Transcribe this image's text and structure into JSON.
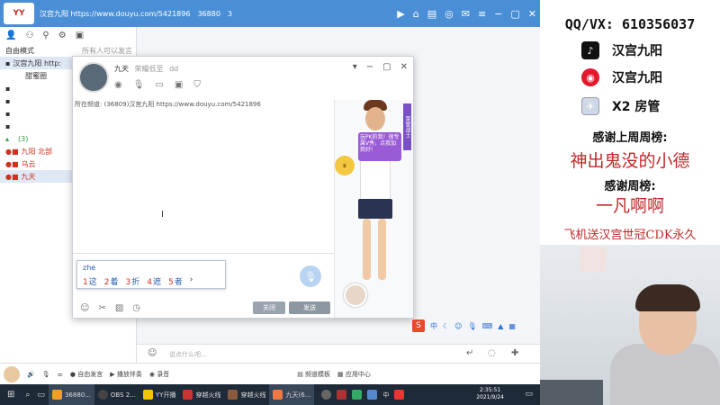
{
  "window": {
    "title": "汉宫九阳 https://www.douyu.com/5421896",
    "room_id": "36880",
    "online_count": "3",
    "logo_text": "YY"
  },
  "sidebar": {
    "mode": "自由模式",
    "search_placeholder": "所有人可以发言",
    "items": [
      {
        "label": "汉宫九阳 http:"
      },
      {
        "label": "甜蜜圈"
      },
      {
        "label": ""
      },
      {
        "label": ""
      },
      {
        "label": ""
      },
      {
        "label": ""
      },
      {
        "label": "(3)"
      },
      {
        "label": "九阳 北部"
      },
      {
        "label": "乌云"
      },
      {
        "label": "九天"
      }
    ]
  },
  "chat_window": {
    "user_name": "九天",
    "user_status": "荣耀低至",
    "user_extra": "dd",
    "notice": "所在频道: (36809)汉宫九阳 https://www.douyu.com/5421896",
    "ime_code": "zhe",
    "ime_candidates": [
      {
        "num": "1",
        "word": "这"
      },
      {
        "num": "2",
        "word": "着"
      },
      {
        "num": "3",
        "word": "折"
      },
      {
        "num": "4",
        "word": "遮"
      },
      {
        "num": "5",
        "word": "者"
      }
    ],
    "close_label": "关闭",
    "send_label": "发送",
    "figure_badge": "荣誉战士",
    "figure_speech": "玩PK的我！很专属V秀，点我加我好!"
  },
  "main": {
    "chat_placeholder": "说点什么吧...",
    "scroll_marker": ")"
  },
  "statusbar": {
    "items": [
      "自由发言",
      "播放伴奏",
      "录音",
      "频道模板",
      "应用中心"
    ]
  },
  "taskbar": {
    "items": [
      "36880...",
      "OBS 2...",
      "YY开播",
      "穿越火线",
      "穿越火线",
      "九天(6..."
    ],
    "time": "2:35:51",
    "date": "2021/9/24",
    "ime_indicator": "中"
  },
  "overlay": {
    "contact": "QQ/VX: 610356037",
    "douyin": "汉宫九阳",
    "weibo": "汉宫九阳",
    "fangguan": "X2 房管",
    "last_week_label": "感谢上周周榜:",
    "last_week_name": "神出鬼没的小德",
    "week_label": "感谢周榜:",
    "week_name": "一凡啊啊",
    "promo": "飞机送汉宫世冠CDK永久"
  },
  "colors": {
    "titlebar": "#4a8fd6",
    "accent_red": "#c02828",
    "taskbar": "#1e2a38"
  }
}
